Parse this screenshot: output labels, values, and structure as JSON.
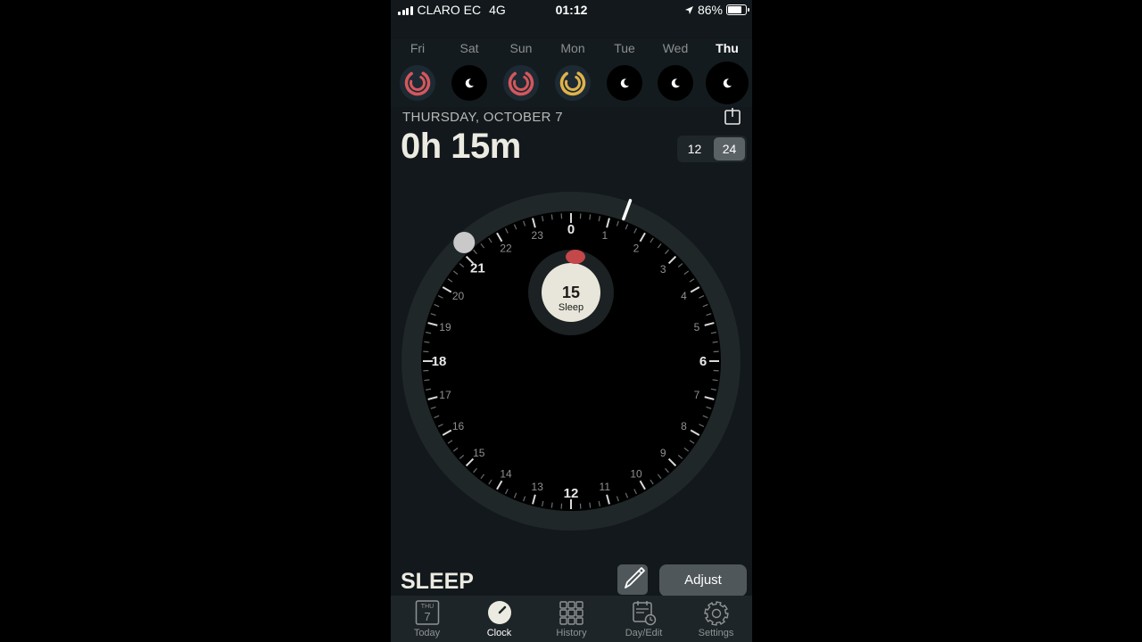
{
  "status_bar": {
    "carrier": "CLARO EC",
    "network": "4G",
    "time": "01:12",
    "battery": "86%",
    "battery_level": 0.86
  },
  "week": [
    {
      "label": "Fri",
      "ring": "red"
    },
    {
      "label": "Sat",
      "ring": "none"
    },
    {
      "label": "Sun",
      "ring": "red"
    },
    {
      "label": "Mon",
      "ring": "gold"
    },
    {
      "label": "Tue",
      "ring": "none"
    },
    {
      "label": "Wed",
      "ring": "none"
    },
    {
      "label": "Thu",
      "ring": "none",
      "selected": true
    }
  ],
  "header": {
    "date": "THURSDAY, OCTOBER 7",
    "duration": "0h 15m",
    "format_options": [
      "12",
      "24"
    ],
    "format_selected": "24"
  },
  "clock": {
    "hour_labels": [
      "0",
      "1",
      "2",
      "3",
      "4",
      "5",
      "6",
      "7",
      "8",
      "9",
      "10",
      "11",
      "12",
      "13",
      "14",
      "15",
      "16",
      "17",
      "18",
      "19",
      "20",
      "21",
      "22",
      "23"
    ],
    "bold_hours": [
      "0",
      "6",
      "12",
      "18",
      "21"
    ],
    "center_value": "15",
    "center_label": "Sleep",
    "sleep_start_hour": 21.2,
    "marker_hour": 1.35
  },
  "footer": {
    "title": "SLEEP",
    "adjust_label": "Adjust"
  },
  "tabs": [
    {
      "label": "Today",
      "icon": "calendar-day-icon",
      "badge_top": "THU",
      "badge_num": "7"
    },
    {
      "label": "Clock",
      "icon": "clock-icon",
      "active": true
    },
    {
      "label": "History",
      "icon": "grid-icon"
    },
    {
      "label": "Day/Edit",
      "icon": "calendar-clock-icon"
    },
    {
      "label": "Settings",
      "icon": "gear-icon"
    }
  ],
  "colors": {
    "ring_red": "#d4575c",
    "ring_gold": "#e0b24a",
    "accent_sleep": "#c4474a",
    "background": "#12181b"
  }
}
